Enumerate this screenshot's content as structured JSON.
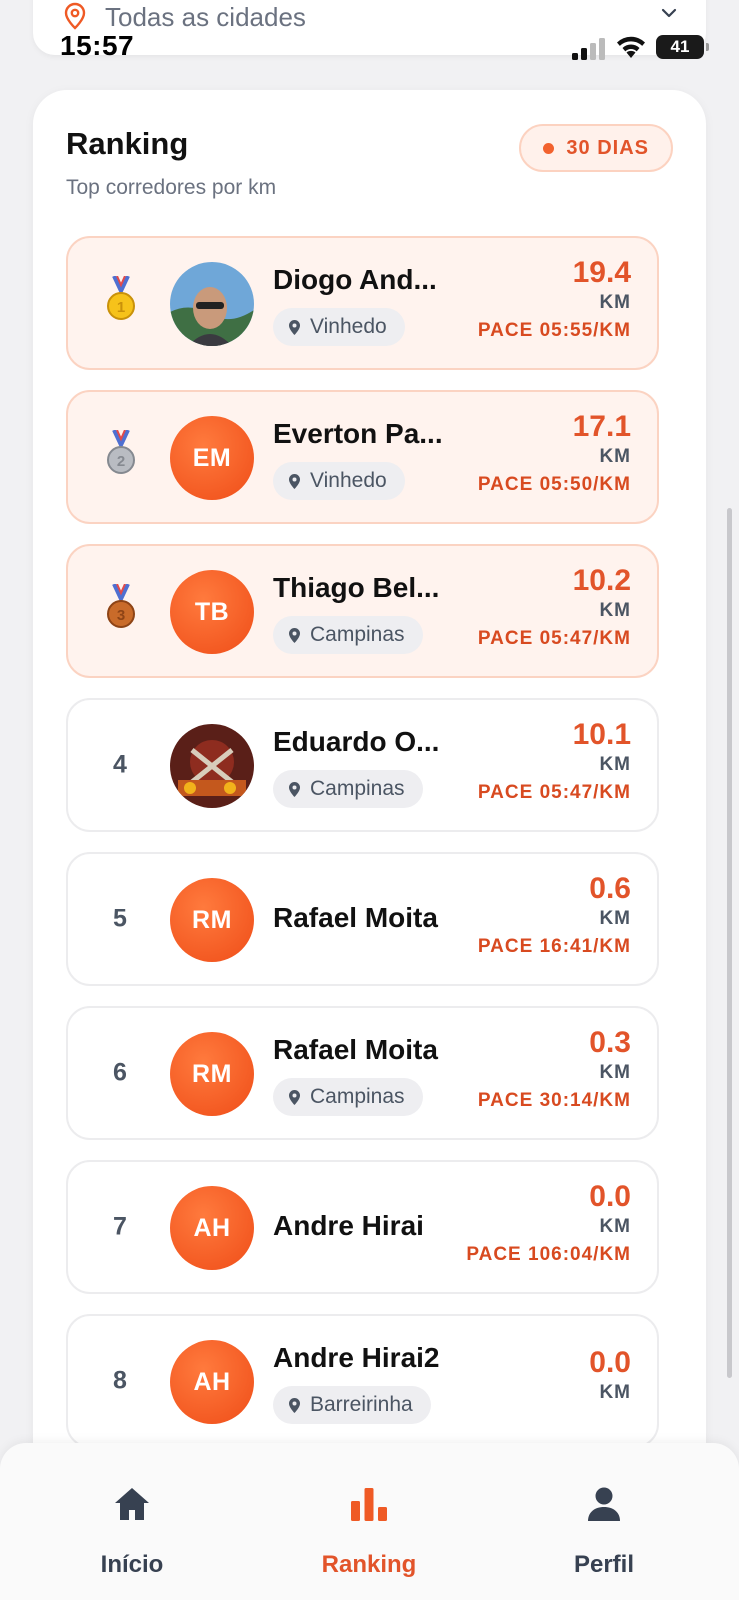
{
  "status_bar": {
    "time": "15:57",
    "battery": "41"
  },
  "city_filter": {
    "label": "Todas as cidades"
  },
  "ranking": {
    "title": "Ranking",
    "subtitle": "Top corredores por km",
    "period_badge": "30 DIAS",
    "km_unit": "KM",
    "rows": [
      {
        "rank": "1",
        "medal": "gold",
        "avatar": "photo",
        "name": "Diogo And...",
        "city": "Vinhedo",
        "km": "19.4",
        "pace": "PACE 05:55/KM"
      },
      {
        "rank": "2",
        "medal": "silver",
        "avatar": "EM",
        "name": "Everton Pa...",
        "city": "Vinhedo",
        "km": "17.1",
        "pace": "PACE 05:50/KM"
      },
      {
        "rank": "3",
        "medal": "bronze",
        "avatar": "TB",
        "name": "Thiago Bel...",
        "city": "Campinas",
        "km": "10.2",
        "pace": "PACE 05:47/KM"
      },
      {
        "rank": "4",
        "avatar": "photo",
        "name": "Eduardo O...",
        "city": "Campinas",
        "km": "10.1",
        "pace": "PACE 05:47/KM"
      },
      {
        "rank": "5",
        "avatar": "RM",
        "name": "Rafael Moita",
        "city": "",
        "km": "0.6",
        "pace": "PACE 16:41/KM"
      },
      {
        "rank": "6",
        "avatar": "RM",
        "name": "Rafael Moita",
        "city": "Campinas",
        "km": "0.3",
        "pace": "PACE 30:14/KM"
      },
      {
        "rank": "7",
        "avatar": "AH",
        "name": "Andre Hirai",
        "city": "",
        "km": "0.0",
        "pace": "PACE 106:04/KM"
      },
      {
        "rank": "8",
        "avatar": "AH",
        "name": "Andre Hirai2",
        "city": "Barreirinha",
        "km": "0.0",
        "pace": ""
      }
    ]
  },
  "nav": {
    "items": [
      {
        "label": "Início",
        "icon": "home-icon",
        "active": false
      },
      {
        "label": "Ranking",
        "icon": "bar-chart-icon",
        "active": true
      },
      {
        "label": "Perfil",
        "icon": "user-icon",
        "active": false
      }
    ]
  },
  "colors": {
    "accent": "#e2542a",
    "accent_light": "#fff3ee",
    "text_muted": "#6b7280"
  }
}
